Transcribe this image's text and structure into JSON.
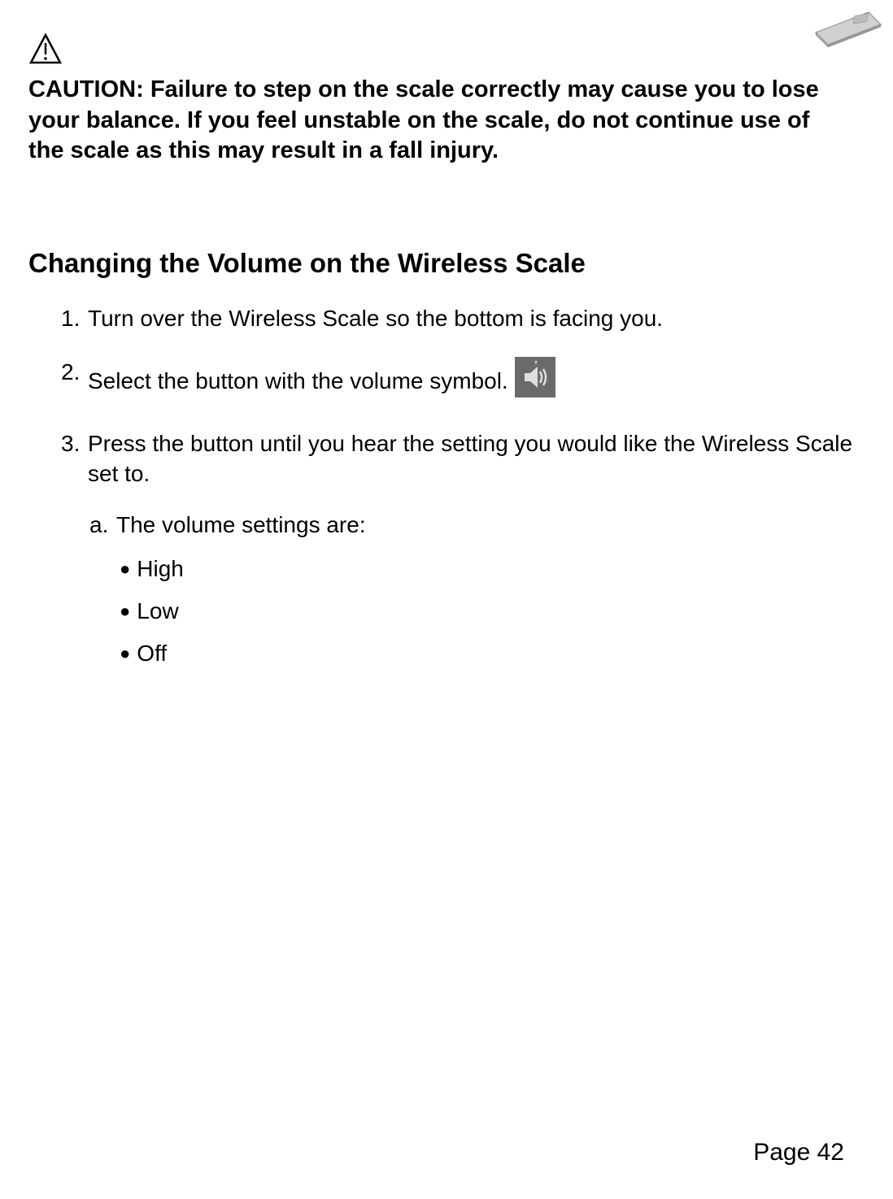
{
  "caution": {
    "text": "CAUTION: Failure to step on the scale correctly may cause you to lose your balance.  If you feel unstable on the scale, do not continue use of the scale as this may result in a fall injury."
  },
  "section": {
    "heading": "Changing the Volume on the Wireless Scale"
  },
  "steps": {
    "step1": {
      "num": "1.",
      "text": "Turn over the Wireless Scale so the bottom is facing you."
    },
    "step2": {
      "num": "2.",
      "text": "Select the button with the volume symbol."
    },
    "step3": {
      "num": "3.",
      "text": "Press the button until you hear the setting you would like the Wireless Scale set to."
    },
    "substep_a": {
      "num": "a.",
      "text": "The volume settings are:"
    },
    "bullets": {
      "b1": "High",
      "b2": "Low",
      "b3": "Off"
    }
  },
  "footer": {
    "page": "Page 42"
  }
}
